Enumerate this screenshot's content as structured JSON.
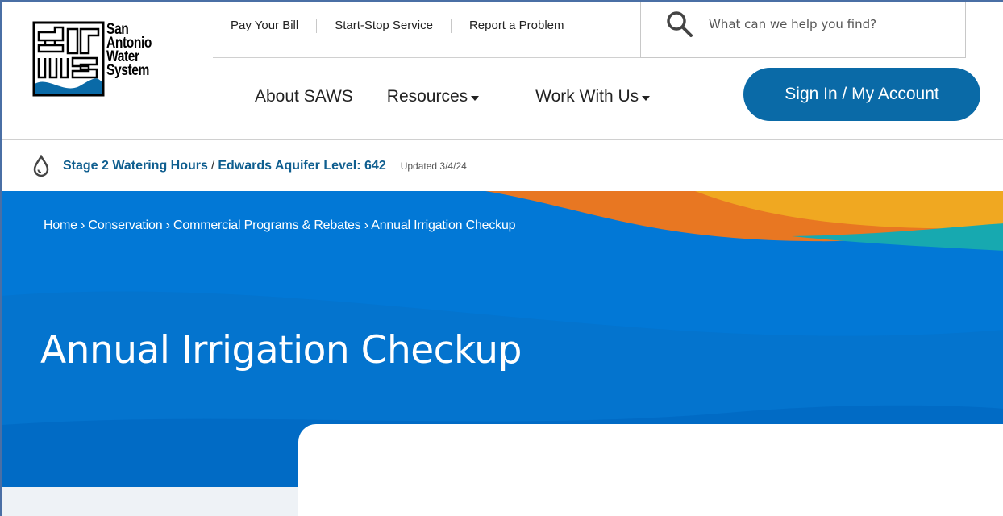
{
  "logo": {
    "org_line1": "San",
    "org_line2": "Antonio",
    "org_line3": "Water",
    "org_line4": "System",
    "brand_color": "#0a6aa7"
  },
  "utility_nav": {
    "items": [
      {
        "label": "Pay Your Bill"
      },
      {
        "label": "Start-Stop Service"
      },
      {
        "label": "Report a Problem"
      }
    ]
  },
  "search": {
    "icon": "search-icon",
    "placeholder": "What can we help you find?"
  },
  "main_nav": {
    "items": [
      {
        "label": "About SAWS"
      },
      {
        "label": "Resources"
      },
      {
        "label": "Work With Us"
      }
    ]
  },
  "account": {
    "signin_label": "Sign In / My Account"
  },
  "alert": {
    "icon": "water-drop-icon",
    "watering_link": "Stage 2 Watering Hours",
    "separator": "/",
    "aquifer_link": "Edwards Aquifer Level: 642",
    "updated": "Updated 3/4/24"
  },
  "breadcrumb": {
    "items": [
      "Home",
      "Conservation",
      "Commercial Programs & Rebates",
      "Annual Irrigation Checkup"
    ],
    "separator": "›"
  },
  "hero": {
    "title": "Annual Irrigation Checkup",
    "bg_color": "#0278d6",
    "accent_orange": "#e87722",
    "accent_yellow": "#f0a821",
    "accent_teal": "#17a9b0"
  }
}
